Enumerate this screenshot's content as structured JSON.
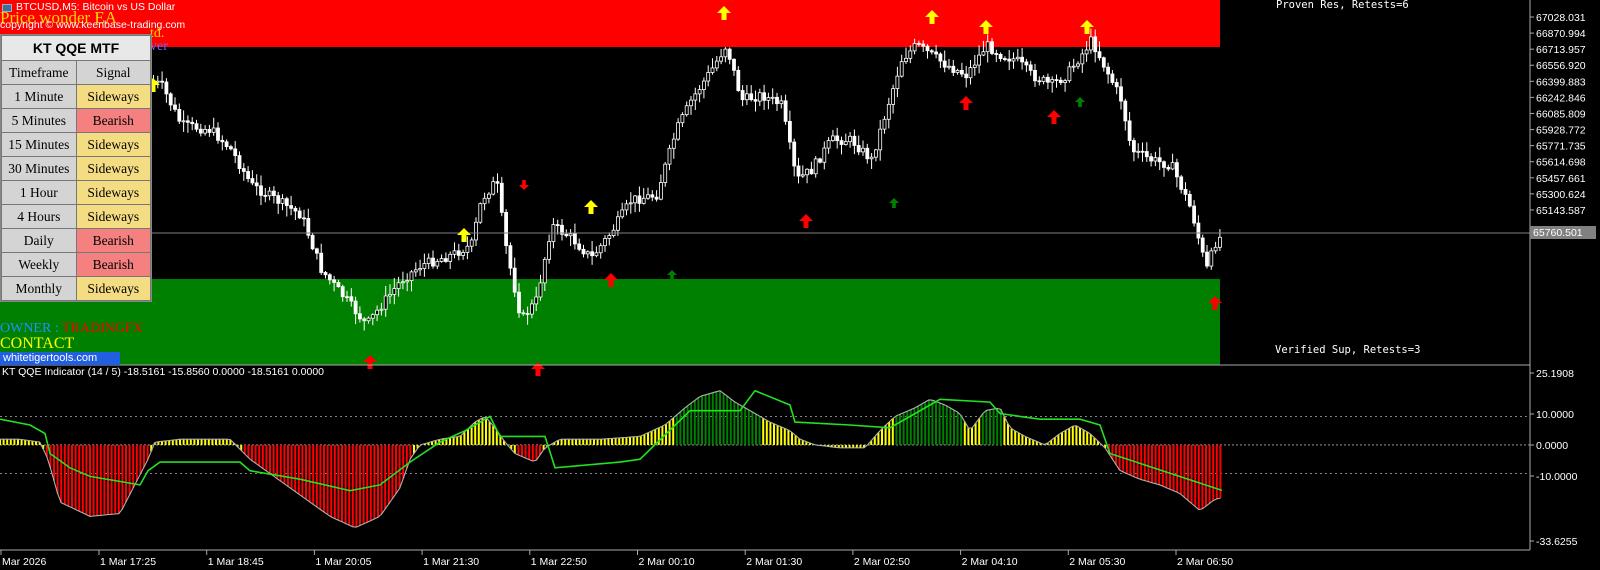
{
  "header": {
    "symbol": "BTCUSD",
    "timeframe": "M5",
    "description": "Bitcoin vs US Dollar",
    "label": "BTCUSD,M5:  Bitcoin vs US Dollar",
    "ea_name": "Price wonder EA",
    "copyright": "copyright © www.keenbase-trading.com",
    "partial_text_1": "td.",
    "partial_text_2": "ver"
  },
  "zones": {
    "resistance_label": "Proven Res, Retests=6",
    "support_label": "Verified Sup, Retests=3",
    "colors": {
      "resistance": "#ff0000",
      "support": "#008000"
    }
  },
  "mtf_panel": {
    "title": "KT QQE MTF",
    "headers": [
      "Timeframe",
      "Signal"
    ],
    "rows": [
      {
        "timeframe": "1 Minute",
        "signal": "Sideways"
      },
      {
        "timeframe": "5 Minutes",
        "signal": "Bearish"
      },
      {
        "timeframe": "15 Minutes",
        "signal": "Sideways"
      },
      {
        "timeframe": "30 Minutes",
        "signal": "Sideways"
      },
      {
        "timeframe": "1 Hour",
        "signal": "Sideways"
      },
      {
        "timeframe": "4 Hours",
        "signal": "Sideways"
      },
      {
        "timeframe": "Daily",
        "signal": "Bearish"
      },
      {
        "timeframe": "Weekly",
        "signal": "Bearish"
      },
      {
        "timeframe": "Monthly",
        "signal": "Sideways"
      }
    ],
    "colors": {
      "Sideways": "#f4dc82",
      "Bearish": "#f48080"
    }
  },
  "footer_labels": {
    "owner_prefix": "OWNER : ",
    "owner_name": "TRADINGFX",
    "contact": "CONTACT",
    "website": "whitetigertools.com"
  },
  "price_axis": {
    "labels": [
      "67028.031",
      "66870.994",
      "66713.957",
      "66556.920",
      "66399.883",
      "66242.846",
      "66085.809",
      "65928.772",
      "65771.735",
      "65614.698",
      "65457.661",
      "65300.624",
      "65143.587"
    ],
    "current_price": "65760.501"
  },
  "indicator": {
    "label": "KT QQE Indicator (14 / 5) -18.5161 -15.8560 0.0000 -18.5161 0.0000",
    "axis_labels": [
      "25.1908",
      "10.0000",
      "0.0000",
      "-10.0000",
      "-33.6255"
    ],
    "levels": [
      10,
      0,
      -10
    ],
    "range": [
      -33.6255,
      25.1908
    ]
  },
  "time_axis": {
    "labels": [
      "Mar 2026",
      "1 Mar 17:25",
      "1 Mar 18:45",
      "1 Mar 20:05",
      "1 Mar 21:30",
      "1 Mar 22:50",
      "2 Mar 00:10",
      "2 Mar 01:30",
      "2 Mar 02:50",
      "2 Mar 04:10",
      "2 Mar 05:30",
      "2 Mar 06:50"
    ]
  }
}
